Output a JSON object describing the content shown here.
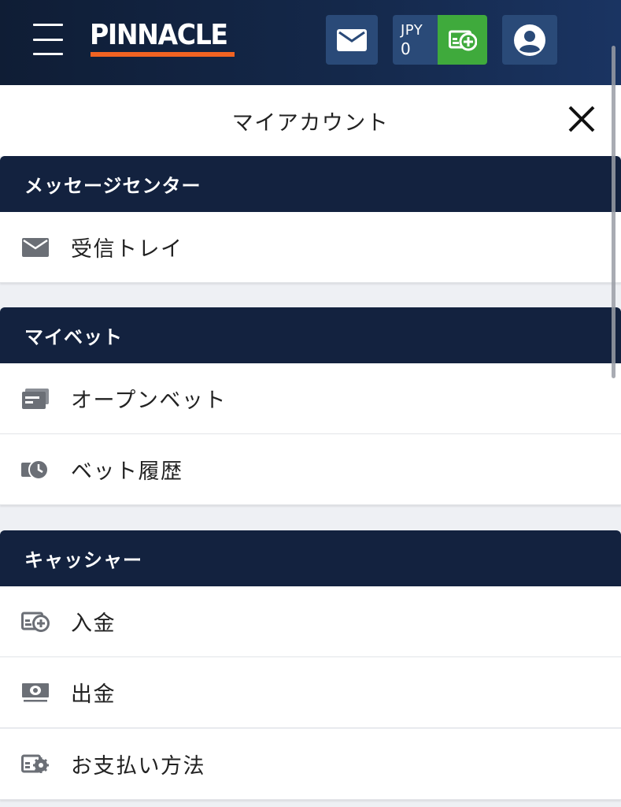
{
  "header": {
    "logo_text": "PINNACLE",
    "balance_currency": "JPY",
    "balance_amount": "0",
    "logo_underline_color": "#f16322",
    "deposit_color": "#3faa3c"
  },
  "panel": {
    "title": "マイアカウント"
  },
  "sections": [
    {
      "title": "メッセージセンター",
      "items": [
        {
          "label": "受信トレイ",
          "icon": "envelope-icon"
        }
      ]
    },
    {
      "title": "マイベット",
      "items": [
        {
          "label": "オープンベット",
          "icon": "bet-slip-icon"
        },
        {
          "label": "ベット履歴",
          "icon": "bet-history-clock-icon"
        }
      ]
    },
    {
      "title": "キャッシャー",
      "items": [
        {
          "label": "入金",
          "icon": "deposit-icon"
        },
        {
          "label": "出金",
          "icon": "withdraw-cash-icon"
        },
        {
          "label": "お支払い方法",
          "icon": "payment-settings-icon"
        }
      ]
    }
  ]
}
